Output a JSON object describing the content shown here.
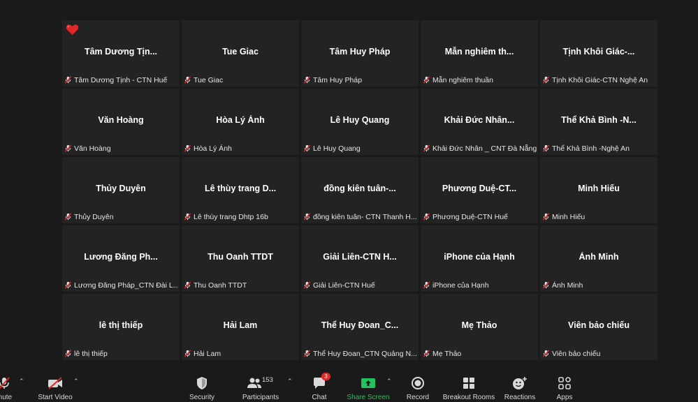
{
  "participants": [
    {
      "display_name": "Tâm Dương Tịn...",
      "footer_name": "Tâm Dương Tịnh - CTN Huế"
    },
    {
      "display_name": "Tue Giac",
      "footer_name": "Tue Giac"
    },
    {
      "display_name": "Tâm Huy Pháp",
      "footer_name": "Tâm Huy Pháp"
    },
    {
      "display_name": "Mẫn nghiêm th...",
      "footer_name": "Mẫn nghiêm thuần"
    },
    {
      "display_name": "Tịnh Khôi Giác-...",
      "footer_name": "Tịnh Khôi Giác-CTN Nghệ An"
    },
    {
      "display_name": "Văn Hoàng",
      "footer_name": "Văn Hoàng"
    },
    {
      "display_name": "Hòa Lý Ánh",
      "footer_name": "Hòa Lý Ánh"
    },
    {
      "display_name": "Lê Huy Quang",
      "footer_name": "Lê Huy Quang"
    },
    {
      "display_name": "Khải Đức Nhân...",
      "footer_name": "Khải Đức Nhân _ CNT Đà Nẵng"
    },
    {
      "display_name": "Thể Khả Bình -N...",
      "footer_name": "Thể Khả Bình -Nghệ An"
    },
    {
      "display_name": "Thủy Duyên",
      "footer_name": "Thủy Duyên"
    },
    {
      "display_name": "Lê thùy trang D...",
      "footer_name": "Lê thùy trang Dhtp 16b"
    },
    {
      "display_name": "đồng kiên tuân-...",
      "footer_name": "đồng kiên tuân- CTN Thanh H..."
    },
    {
      "display_name": "Phương Duệ-CT...",
      "footer_name": "Phương Duệ-CTN Huế"
    },
    {
      "display_name": "Minh Hiếu",
      "footer_name": "Minh Hiếu"
    },
    {
      "display_name": "Lương Đăng Ph...",
      "footer_name": "Lương Đăng Pháp_CTN Đài L..."
    },
    {
      "display_name": "Thu Oanh TTDT",
      "footer_name": "Thu Oanh TTDT"
    },
    {
      "display_name": "Giải Liên-CTN H...",
      "footer_name": "Giải Liên-CTN Huế"
    },
    {
      "display_name": "iPhone của Hạnh",
      "footer_name": "iPhone của Hạnh"
    },
    {
      "display_name": "Ánh Minh",
      "footer_name": "Ánh Minh"
    },
    {
      "display_name": "lê thị thiếp",
      "footer_name": "lê thị thiếp"
    },
    {
      "display_name": "Hải Lam",
      "footer_name": "Hải Lam"
    },
    {
      "display_name": "Thể Huy Đoan_C...",
      "footer_name": "Thể Huy Đoan_CTN Quảng N..."
    },
    {
      "display_name": "Mẹ Thảo",
      "footer_name": "Mẹ Thảo"
    },
    {
      "display_name": "Viên bảo chiếu",
      "footer_name": "Viên bảo chiếu"
    }
  ],
  "toolbar": {
    "unmute_label": "mute",
    "start_video_label": "Start Video",
    "security_label": "Security",
    "participants_label": "Participants",
    "participants_count": "153",
    "chat_label": "Chat",
    "chat_badge": "3",
    "share_screen_label": "Share Screen",
    "record_label": "Record",
    "breakout_rooms_label": "Breakout Rooms",
    "reactions_label": "Reactions",
    "apps_label": "Apps",
    "share_color": "#22c35e",
    "badge_color": "#e02828"
  },
  "reaction_icon": "heart-icon",
  "mute_icon": "mic-muted-icon"
}
